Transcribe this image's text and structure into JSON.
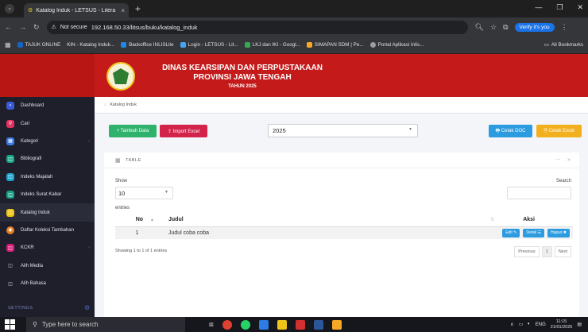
{
  "browser": {
    "tab_title": "Katalog Induk - LETSUS - Litera",
    "tab_close": "×",
    "new_tab": "+",
    "not_secure": "Not secure",
    "url": "192.168.50.33/litsus/buku/katalog_induk",
    "verify": "Verify it's you",
    "bookmarks": [
      "TAJUK ONLINE",
      "KIN - Katalog Induk...",
      "Backoffice INLISLite",
      "Login - LETSUS - Lit...",
      "LKJ dan IKI - Googl...",
      "SIMAPAN SDM | Pe...",
      "Portal Aplikasi Inlis..."
    ],
    "all_bookmarks": "All Bookmarks"
  },
  "header": {
    "line1": "DINAS KEARSIPAN DAN PERPUSTAKAAN",
    "line2": "PROVINSI JAWA TENGAH",
    "line3": "TAHUN 2025"
  },
  "sidebar": {
    "items": [
      {
        "label": "Dashboard",
        "color": "#3a5bd9"
      },
      {
        "label": "Cari",
        "color": "#e0315f"
      },
      {
        "label": "Kategori",
        "color": "#3d7be6"
      },
      {
        "label": "Bibliografi",
        "color": "#17a589"
      },
      {
        "label": "Indeks Majalah",
        "color": "#1aa3cf"
      },
      {
        "label": "Indeks Surat Kabar",
        "color": "#16a085"
      },
      {
        "label": "Katalog Induk",
        "color": "#f1c40f"
      },
      {
        "label": "Daftar Koleksi Tambahan",
        "color": "#e67e22"
      },
      {
        "label": "KCKR",
        "color": "#d81b78"
      },
      {
        "label": "Alih Media",
        "color": "#555566"
      },
      {
        "label": "Alih Bahasa",
        "color": "#555566"
      }
    ],
    "settings": "SETTINGS"
  },
  "breadcrumb": {
    "page": "Katalog Induk"
  },
  "toolbar": {
    "tambah": "+ Tambah Data",
    "import": "⇪ Import Excel",
    "year": "2025",
    "cetak_doc": "🖶 Cetak DOC",
    "cetak_excel": "🗎 Cetak Excel"
  },
  "card": {
    "title": "TABLE",
    "show_label": "Show",
    "show_value": "10",
    "entries_label": "entries",
    "search_label": "Search",
    "columns": {
      "no": "No",
      "judul": "Judul",
      "aksi": "Aksi"
    },
    "rows": [
      {
        "no": "1",
        "judul": "Judul coba coba"
      }
    ],
    "actions": {
      "edit": "Edit ✎",
      "detail": "Detail ☰",
      "hapus": "Hapus ✖"
    },
    "info": "Showing 1 to 1 of 1 entries",
    "pager": {
      "prev": "Previous",
      "page": "1",
      "next": "Next"
    }
  },
  "taskbar": {
    "search_placeholder": "Type here to search",
    "lang": "ENG",
    "time": "11:15",
    "date": "21/01/2025"
  }
}
